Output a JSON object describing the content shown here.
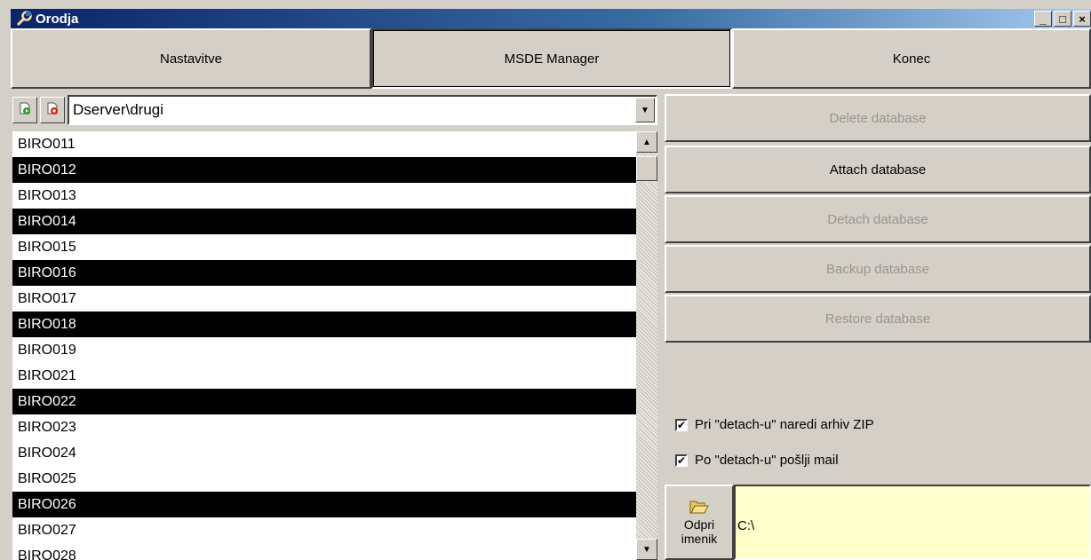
{
  "window": {
    "title": "Orodja",
    "icon": "tools-icon",
    "controls": [
      "_",
      "□",
      "×"
    ]
  },
  "tabs": [
    {
      "label": "Nastavitve",
      "active": false
    },
    {
      "label": "MSDE Manager",
      "active": true
    },
    {
      "label": "Konec",
      "active": false
    }
  ],
  "toolbar": {
    "start_icon": "start-server-icon",
    "stop_icon": "stop-server-icon"
  },
  "server_combo": {
    "value": "Dserver\\drugi"
  },
  "databases": [
    {
      "name": "BIRO011",
      "selected": false
    },
    {
      "name": "BIRO012",
      "selected": true
    },
    {
      "name": "BIRO013",
      "selected": false
    },
    {
      "name": "BIRO014",
      "selected": true
    },
    {
      "name": "BIRO015",
      "selected": false
    },
    {
      "name": "BIRO016",
      "selected": true
    },
    {
      "name": "BIRO017",
      "selected": false
    },
    {
      "name": "BIRO018",
      "selected": true
    },
    {
      "name": "BIRO019",
      "selected": false
    },
    {
      "name": "BIRO021",
      "selected": false
    },
    {
      "name": "BIRO022",
      "selected": true
    },
    {
      "name": "BIRO023",
      "selected": false
    },
    {
      "name": "BIRO024",
      "selected": false
    },
    {
      "name": "BIRO025",
      "selected": false
    },
    {
      "name": "BIRO026",
      "selected": true
    },
    {
      "name": "BIRO027",
      "selected": false
    },
    {
      "name": "BIRO028",
      "selected": false
    }
  ],
  "actions": [
    {
      "label": "Delete database",
      "enabled": false
    },
    {
      "label": "Attach database",
      "enabled": true
    },
    {
      "label": "Detach database",
      "enabled": false
    },
    {
      "label": "Backup database",
      "enabled": false
    },
    {
      "label": "Restore database",
      "enabled": false
    }
  ],
  "options": {
    "zip_label": "Pri \"detach-u\" naredi arhiv ZIP",
    "zip_checked": true,
    "mail_label": "Po \"detach-u\" pošlji mail",
    "mail_checked": true
  },
  "folder": {
    "button_line1": "Odpri",
    "button_line2": "imenik",
    "path": "C:\\"
  },
  "colors": {
    "title_gradient_start": "#0a246a",
    "face": "#d4d0c8",
    "selection": "#000000",
    "path_background": "#ffffcc",
    "disabled_text": "#9a968e"
  }
}
